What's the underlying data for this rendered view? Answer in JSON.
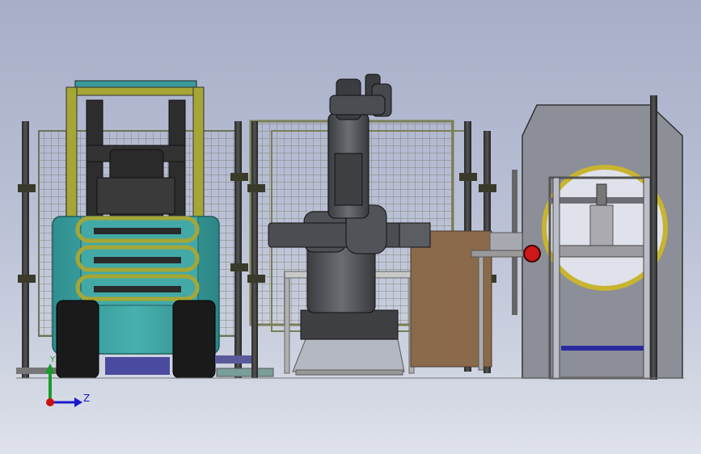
{
  "viewport": {
    "background_top": "#a7aec8",
    "background_bottom": "#dfe2ea"
  },
  "triad": {
    "y_label": "Y",
    "z_label": "Z",
    "y_color": "#1a9a2a",
    "z_color": "#1a1acc",
    "origin_color": "#cc1111"
  },
  "colors": {
    "forklift_body": "#3fa6a6",
    "forklift_mast": "#a6a636",
    "robot": "#4a4d52",
    "wood_panel": "#8a6a4a",
    "mesh": "#8a8f70",
    "machine_frame": "#8c8f98",
    "ring": "#c8b430"
  }
}
